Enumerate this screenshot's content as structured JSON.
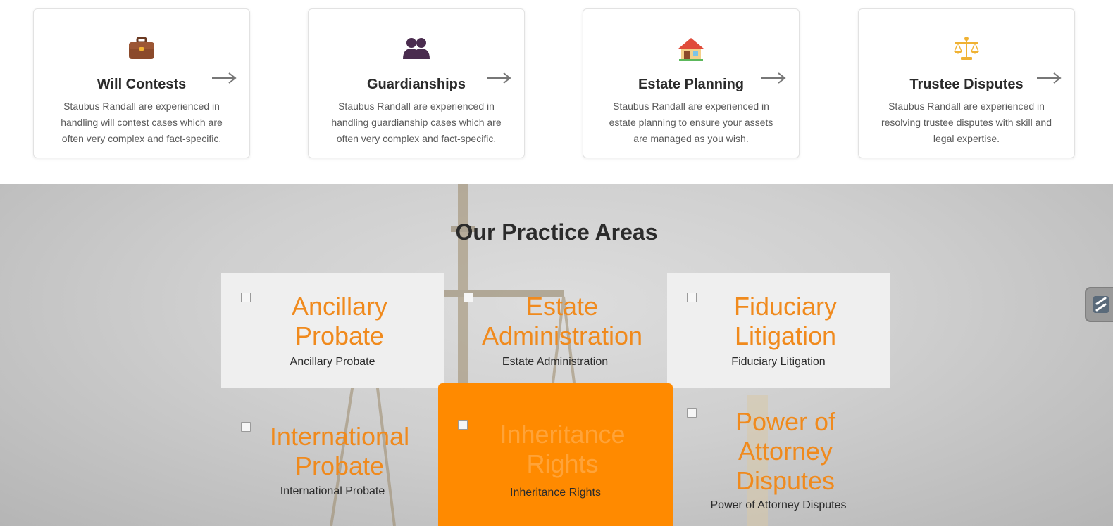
{
  "services": [
    {
      "icon": "briefcase-icon",
      "title": "Will Contests",
      "desc": "Staubus Randall are experienced in handling will contest cases which are often very complex and fact-specific."
    },
    {
      "icon": "people-icon",
      "title": "Guardianships",
      "desc": "Staubus Randall are experienced in handling guardianship cases which are often very complex and fact-specific."
    },
    {
      "icon": "house-icon",
      "title": "Estate Planning",
      "desc": "Staubus Randall are experienced in estate planning to ensure your assets are managed as you wish."
    },
    {
      "icon": "scales-icon",
      "title": "Trustee Disputes",
      "desc": "Staubus Randall are experienced in resolving trustee disputes with skill and legal expertise."
    }
  ],
  "practice": {
    "title": "Our Practice Areas",
    "areas": [
      {
        "big": "Ancillary Probate",
        "small": "Ancillary Probate"
      },
      {
        "big": "Estate Administration",
        "small": "Estate Administration"
      },
      {
        "big": "Fiduciary Litigation",
        "small": "Fiduciary Litigation"
      },
      {
        "big": "International Probate",
        "small": "International Probate"
      },
      {
        "big": "Inheritance Rights",
        "small": "Inheritance Rights"
      },
      {
        "big": "Power of Attorney Disputes",
        "small": "Power of Attorney Disputes"
      }
    ]
  },
  "colors": {
    "accent": "#ff8a00",
    "heading": "#2b2b2b",
    "link_orange": "#f08a1d"
  }
}
